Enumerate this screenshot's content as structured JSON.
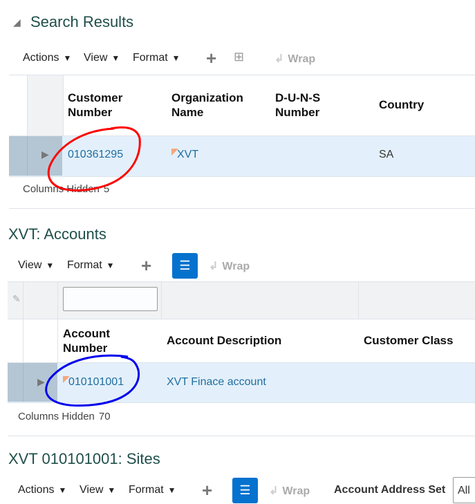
{
  "search_results": {
    "title": "Search Results",
    "toolbar": {
      "actions": "Actions",
      "view": "View",
      "format": "Format",
      "wrap": "Wrap"
    },
    "columns": [
      "Customer Number",
      "Organization Name",
      "D-U-N-S Number",
      "Country"
    ],
    "columns_wrapped": [
      [
        "Customer",
        "Number"
      ],
      [
        "Organization",
        "Name"
      ],
      [
        "D-U-N-S",
        "Number"
      ],
      [
        "Country"
      ]
    ],
    "rows": [
      {
        "customer_number": "010361295",
        "organization_name": "XVT",
        "duns": "",
        "country": "SA"
      }
    ],
    "columns_hidden_label": "Columns Hidden",
    "columns_hidden": "5"
  },
  "accounts": {
    "title": "XVT: Accounts",
    "toolbar": {
      "view": "View",
      "format": "Format",
      "wrap": "Wrap"
    },
    "filter_value": "",
    "columns_wrapped": [
      [
        "Account",
        "Number"
      ],
      [
        "Account Description"
      ],
      [
        "Customer Class"
      ]
    ],
    "rows": [
      {
        "account_number": "010101001",
        "description": "XVT Finace account",
        "customer_class": ""
      }
    ],
    "columns_hidden_label": "Columns Hidden",
    "columns_hidden": "70"
  },
  "sites": {
    "title": "XVT 010101001: Sites",
    "toolbar": {
      "actions": "Actions",
      "view": "View",
      "format": "Format",
      "wrap": "Wrap",
      "address_set_label": "Account Address Set",
      "address_set_value": "All"
    }
  },
  "colors": {
    "title": "#1f4f4a",
    "link": "#1f6ea0",
    "selected_row": "#e3f0fb",
    "selector": "#b4c6d4",
    "accent": "#0572ce",
    "annot_red": "#ff0000",
    "annot_blue": "#0000ee"
  }
}
